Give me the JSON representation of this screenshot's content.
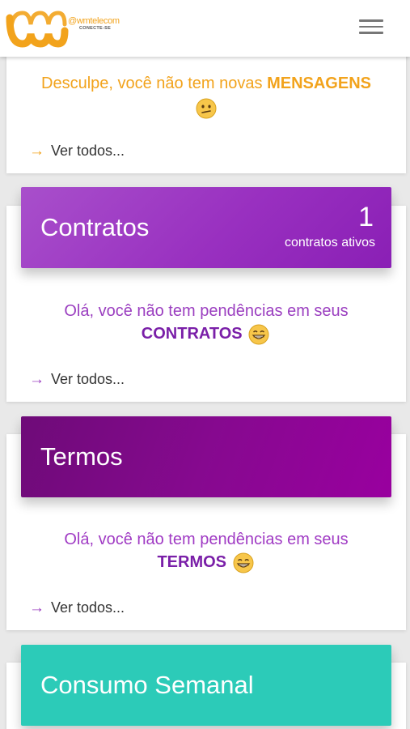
{
  "header": {
    "brand_name": "@wmtelecom",
    "brand_tagline": "CONECTE-SE"
  },
  "messages": {
    "text_before": "Desculpe, você não tem novas",
    "text_bold": "MENSAGENS",
    "see_all": "Ver todos..."
  },
  "contracts": {
    "title": "Contratos",
    "count": "1",
    "count_label": "contratos ativos",
    "text_before": "Olá, você não tem pendências em seus",
    "text_bold": "CONTRATOS",
    "see_all": "Ver todos..."
  },
  "terms": {
    "title": "Termos",
    "text_before": "Olá, você não tem pendências em seus",
    "text_bold": "TERMOS",
    "see_all": "Ver todos..."
  },
  "consumo": {
    "title": "Consumo Semanal"
  },
  "colors": {
    "brand_orange": "#f2a31c",
    "contracts_purple": "#9930c0",
    "terms_purple": "#86098f",
    "consumo_teal": "#2ccbb8"
  },
  "icons": {
    "menu": "hamburger-menu-icon",
    "messages_emoji": "confused-face-emoji",
    "happy_emoji": "grinning-face-emoji",
    "arrow": "arrow-right-icon"
  }
}
